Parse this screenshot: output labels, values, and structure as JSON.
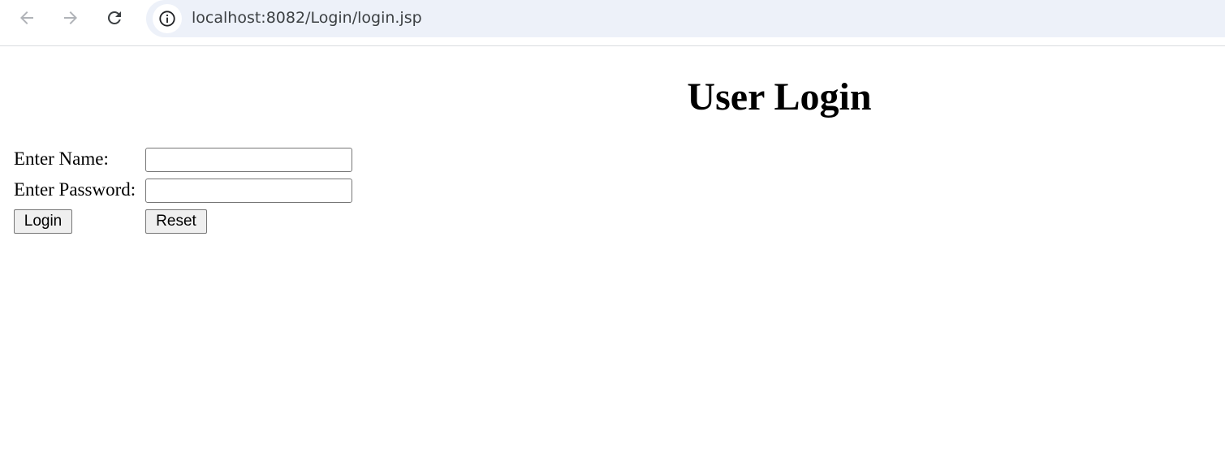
{
  "browser": {
    "url": "localhost:8082/Login/login.jsp",
    "icons": {
      "back": "arrow-left",
      "forward": "arrow-right",
      "reload": "reload",
      "site_info": "info-circle"
    }
  },
  "page": {
    "title": "User Login",
    "form": {
      "name_label": "Enter Name:",
      "name_value": "",
      "password_label": "Enter Password:",
      "password_value": "",
      "login_button": "Login",
      "reset_button": "Reset"
    }
  }
}
